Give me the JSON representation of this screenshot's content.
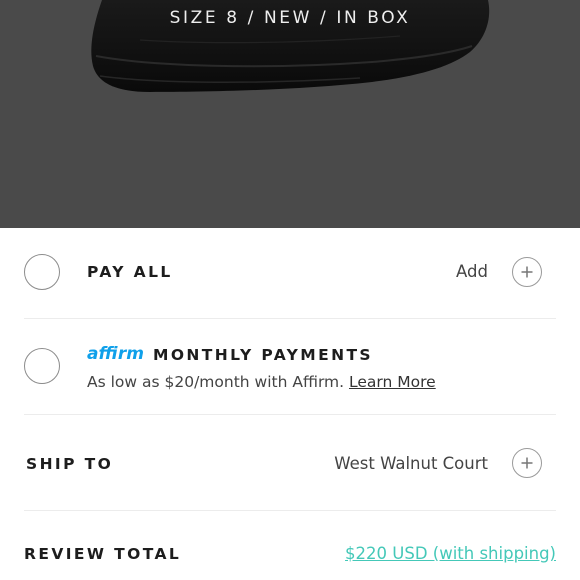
{
  "hero": {
    "caption": "SIZE 8 / NEW / IN BOX",
    "background_color": "#4a4a4a",
    "image": "black-shoe-photo"
  },
  "pay_all": {
    "label": "PAY ALL",
    "action_label": "Add",
    "action_icon": "plus-icon"
  },
  "monthly": {
    "brand": "affirm",
    "brand_color": "#0fa0ea",
    "label": "MONTHLY PAYMENTS",
    "description": "As low as $20/month with Affirm.",
    "link": "Learn More"
  },
  "ship_to": {
    "label": "SHIP TO",
    "value": "West Walnut Court",
    "action_icon": "plus-icon"
  },
  "review_total": {
    "label": "REVIEW TOTAL",
    "value": "$220 USD (with shipping)",
    "value_color": "#44c8b8"
  }
}
